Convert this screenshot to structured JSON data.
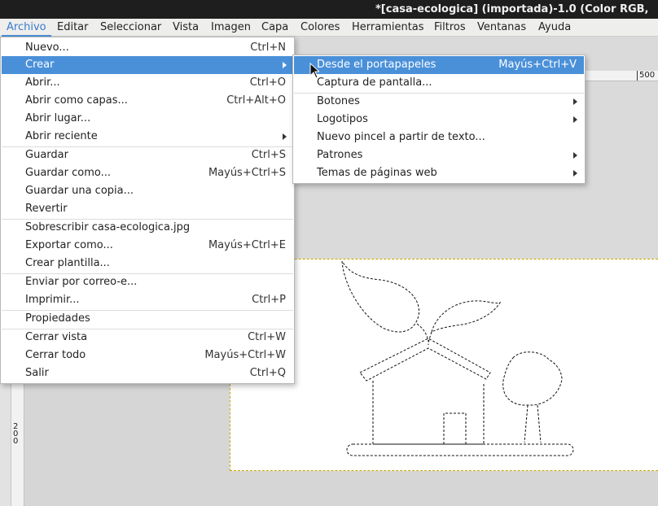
{
  "window": {
    "title": "*[casa-ecologica] (importada)-1.0 (Color RGB,"
  },
  "menubar": {
    "items": [
      "Archivo",
      "Editar",
      "Seleccionar",
      "Vista",
      "Imagen",
      "Capa",
      "Colores",
      "Herramientas",
      "Filtros",
      "Ventanas",
      "Ayuda"
    ],
    "active": "Archivo"
  },
  "file_menu": {
    "items": [
      {
        "label": "Nuevo...",
        "shortcut": "Ctrl+N"
      },
      {
        "label": "Crear",
        "shortcut": "",
        "submenu": true,
        "highlighted": true
      },
      {
        "label": "Abrir...",
        "shortcut": "Ctrl+O"
      },
      {
        "label": "Abrir como capas...",
        "shortcut": "Ctrl+Alt+O"
      },
      {
        "label": "Abrir lugar...",
        "shortcut": ""
      },
      {
        "label": "Abrir reciente",
        "shortcut": "",
        "submenu": true
      },
      {
        "label": "Guardar",
        "shortcut": "Ctrl+S"
      },
      {
        "label": "Guardar como...",
        "shortcut": "Mayús+Ctrl+S"
      },
      {
        "label": "Guardar una copia...",
        "shortcut": ""
      },
      {
        "label": "Revertir",
        "shortcut": ""
      },
      {
        "label": "Sobrescribir casa-ecologica.jpg",
        "shortcut": ""
      },
      {
        "label": "Exportar como...",
        "shortcut": "Mayús+Ctrl+E"
      },
      {
        "label": "Crear plantilla...",
        "shortcut": ""
      },
      {
        "label": "Enviar por correo-e...",
        "shortcut": ""
      },
      {
        "label": "Imprimir...",
        "shortcut": "Ctrl+P"
      },
      {
        "label": "Propiedades",
        "shortcut": ""
      },
      {
        "label": "Cerrar vista",
        "shortcut": "Ctrl+W"
      },
      {
        "label": "Cerrar todo",
        "shortcut": "Mayús+Ctrl+W"
      },
      {
        "label": "Salir",
        "shortcut": "Ctrl+Q"
      }
    ]
  },
  "create_submenu": {
    "items": [
      {
        "label": "Desde el portapapeles",
        "shortcut": "Mayús+Ctrl+V",
        "highlighted": true
      },
      {
        "label": "Captura de pantalla...",
        "shortcut": ""
      },
      {
        "label": "Botones",
        "shortcut": "",
        "submenu": true
      },
      {
        "label": "Logotipos",
        "shortcut": "",
        "submenu": true
      },
      {
        "label": "Nuevo pincel a partir de texto...",
        "shortcut": ""
      },
      {
        "label": "Patrones",
        "shortcut": "",
        "submenu": true
      },
      {
        "label": "Temas de páginas web",
        "shortcut": "",
        "submenu": true
      }
    ]
  },
  "rulers": {
    "top_label": "500",
    "left_label": "200"
  },
  "colors": {
    "highlight": "#4a90d9",
    "titlebar": "#1e1e1e",
    "selection_border": "#c8a600"
  }
}
